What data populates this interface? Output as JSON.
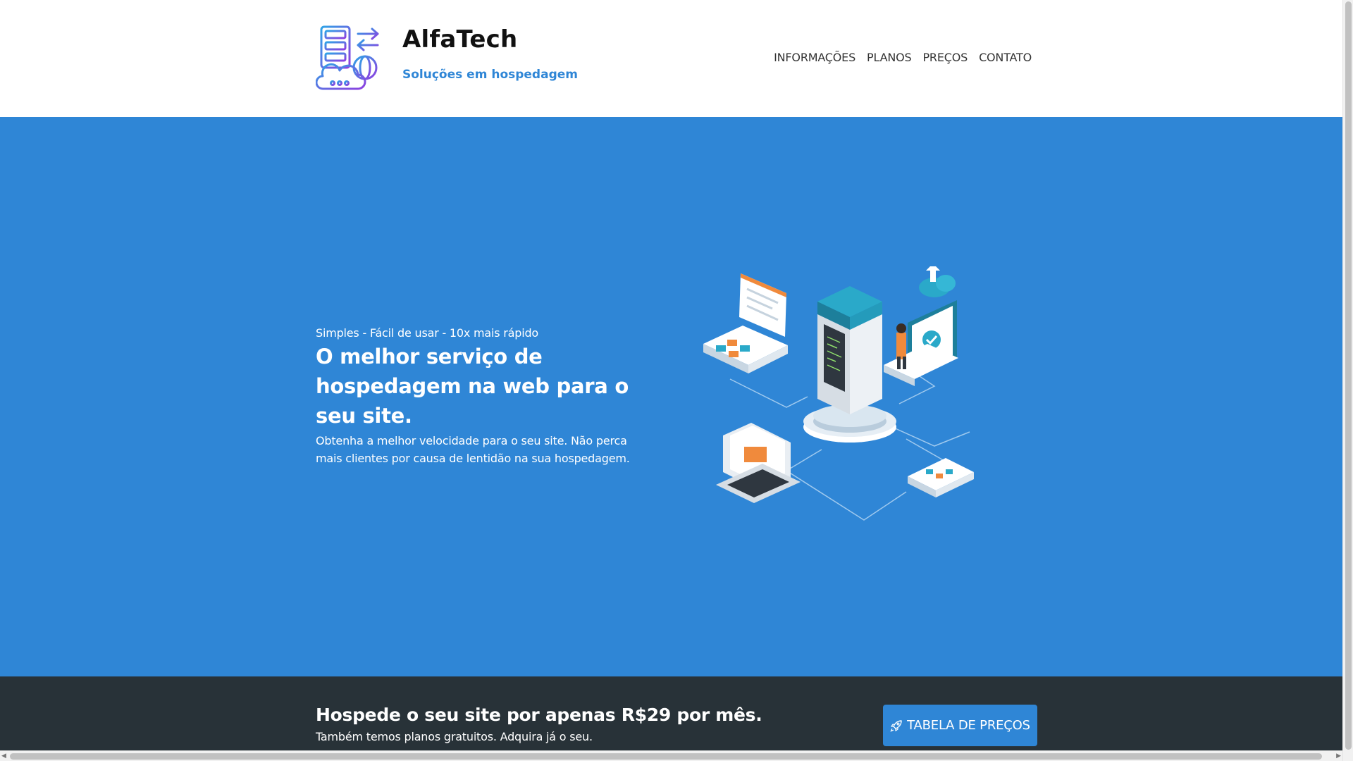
{
  "header": {
    "brand_name": "AlfaTech",
    "tagline": "Soluções em hospedagem",
    "logo_icon": "server-cloud-globe-icon",
    "nav": [
      {
        "label": "INFORMAÇÕES"
      },
      {
        "label": "PLANOS"
      },
      {
        "label": "PREÇOS"
      },
      {
        "label": "CONTATO"
      }
    ]
  },
  "hero": {
    "pretitle": "Simples - Fácil de usar - 10x mais rápido",
    "title": "O melhor serviço de hospedagem na web para o seu site.",
    "description": "Obtenha a melhor velocidade para o seu site. Não perca mais clientes por causa de lentidão na sua hospedagem.",
    "illustration": "isometric-server-network-illustration"
  },
  "cta": {
    "title": "Hospede o seu site por apenas R$29 por mês.",
    "subtitle": "Também temos planos gratuitos. Adquira já o seu.",
    "button_label": "TABELA DE PREÇOS",
    "button_icon": "rocket-icon"
  },
  "colors": {
    "accent": "#2f86d6",
    "cta_background": "#283238",
    "text_dark": "#111111",
    "white": "#ffffff"
  }
}
